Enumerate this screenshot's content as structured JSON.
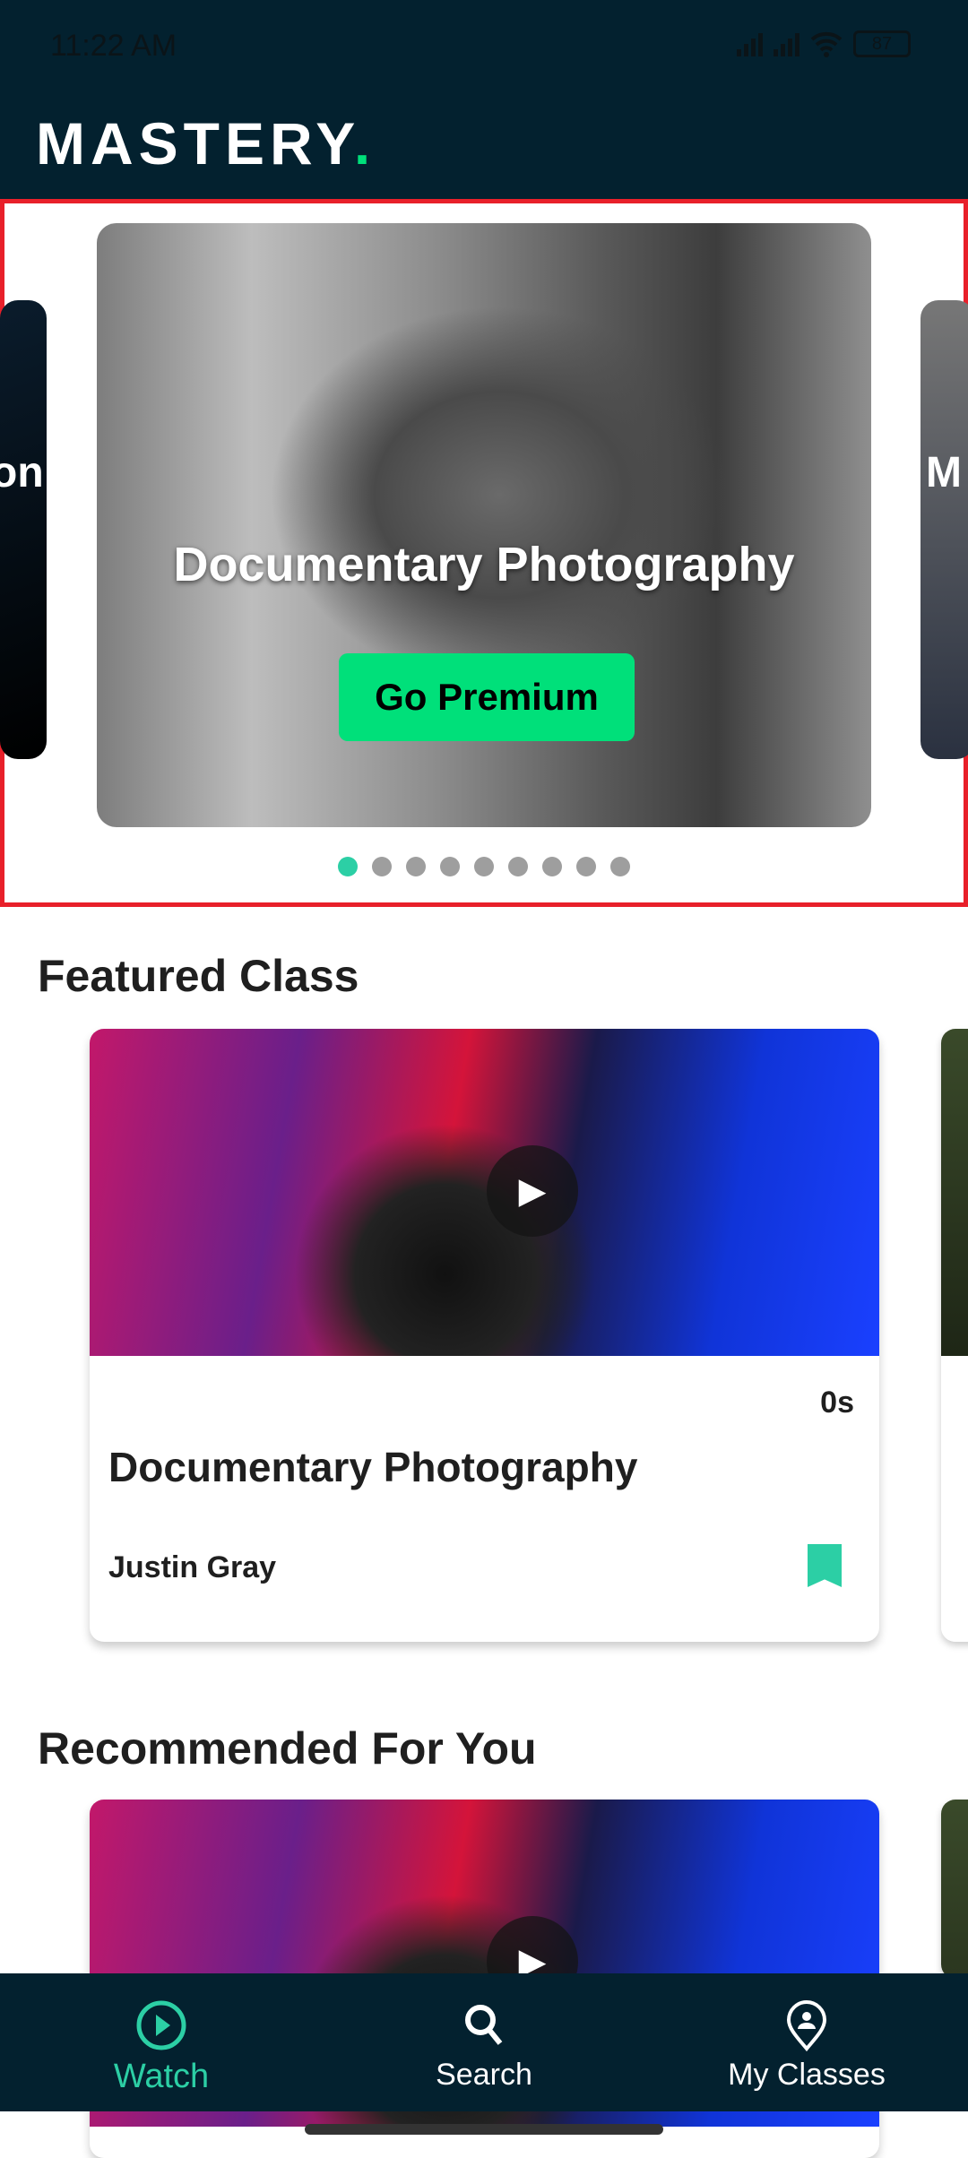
{
  "status_bar": {
    "time": "11:22 AM",
    "battery": "87"
  },
  "header": {
    "logo": "MASTERY",
    "logo_dot": "."
  },
  "hero": {
    "prev_card_text": "on",
    "next_card_text": "M",
    "title": "Documentary Photography",
    "button_label": "Go Premium",
    "slide_count": 9,
    "active_slide": 1
  },
  "featured": {
    "title": "Featured Class",
    "card": {
      "duration": "0s",
      "title": "Documentary Photography",
      "author": "Justin Gray",
      "bookmarked": true
    }
  },
  "recommended": {
    "title": "Recommended For You"
  },
  "nav": {
    "items": [
      {
        "label": "Watch",
        "icon": "play-circle-icon",
        "active": true
      },
      {
        "label": "Search",
        "icon": "search-icon"
      },
      {
        "label": "My Classes",
        "icon": "location-person-icon"
      }
    ]
  },
  "colors": {
    "header_bg": "#03212f",
    "accent": "#2ccfa5",
    "premium": "#00e07a",
    "highlight_border": "#e8202a"
  }
}
